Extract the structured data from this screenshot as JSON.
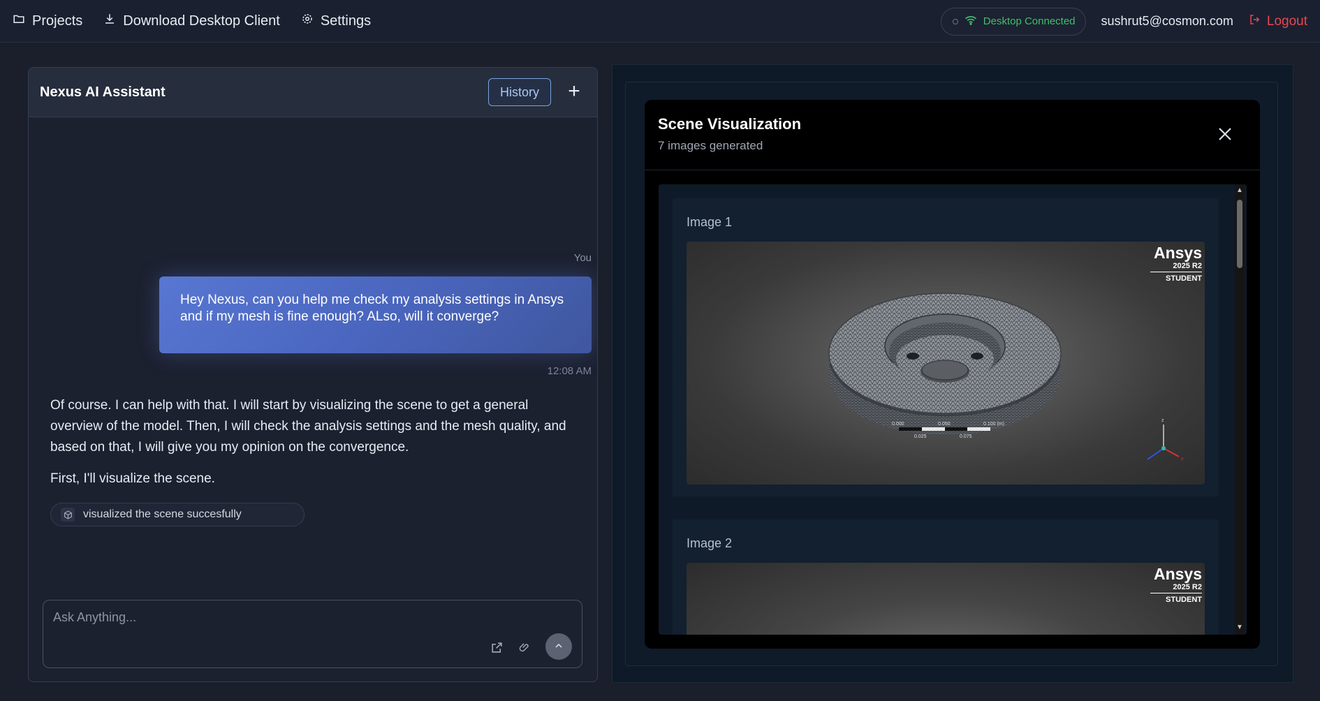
{
  "nav": {
    "projects": "Projects",
    "download": "Download Desktop Client",
    "settings": "Settings"
  },
  "status": {
    "connection": "Desktop Connected",
    "email": "sushrut5@cosmon.com",
    "logout": "Logout"
  },
  "chat": {
    "title": "Nexus AI Assistant",
    "history_label": "History",
    "new_label": "+",
    "sender_label": "You",
    "user_message": "Hey Nexus, can you help me check my analysis settings in Ansys and if my mesh is fine enough? ALso, will it converge?",
    "timestamp": "12:08 AM",
    "assistant_paragraph_1": "Of course. I can help with that. I will start by visualizing the scene to get a general overview of the model. Then, I will check the analysis settings and the mesh quality, and based on that, I will give you my opinion on the convergence.",
    "assistant_paragraph_2": "First, I'll visualize the scene.",
    "tool_result": "visualized the scene succesfully",
    "input_placeholder": "Ask Anything..."
  },
  "scene": {
    "title": "Scene Visualization",
    "subtitle": "7 images generated",
    "images": [
      {
        "label": "Image 1"
      },
      {
        "label": "Image 2"
      }
    ],
    "badge": {
      "name": "Ansys",
      "version": "2025 R2",
      "edition": "STUDENT"
    },
    "scale_ticks_top": [
      "0.000",
      "0.050",
      "0.100 (m)"
    ],
    "scale_ticks_bottom": [
      "0.025",
      "0.075"
    ],
    "triad_labels": [
      "z",
      "x"
    ]
  },
  "colors": {
    "accent": "#5877d2",
    "connected": "#3fbf6e",
    "logout": "#e5484d"
  }
}
